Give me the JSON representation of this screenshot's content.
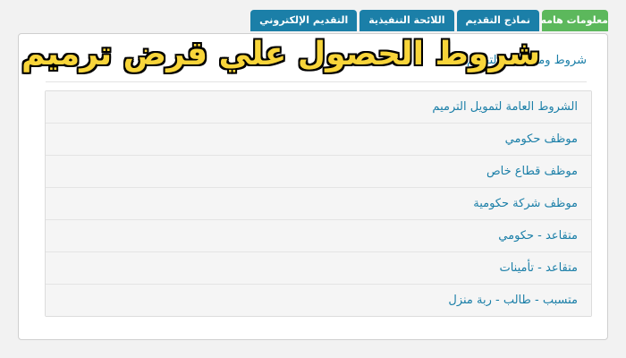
{
  "tabs": [
    {
      "label": "معلومات هامه",
      "active": true
    },
    {
      "label": "نماذج التقديم",
      "active": false
    },
    {
      "label": "اللائحة التنفيذية",
      "active": false
    },
    {
      "label": "التقديم الإلكتروني",
      "active": false
    }
  ],
  "panel": {
    "title": "شروط ومتطلبات التقديم"
  },
  "overlay": {
    "title": "شروط الحصول علي قرض ترميم"
  },
  "list_items": [
    "الشروط العامة لتمويل الترميم",
    "موظف حكومي",
    "موظف قطاع خاص",
    "موظف شركة حكومية",
    "متقاعد - حكومي",
    "متقاعد - تأمينات",
    "متسبب - طالب - ربة منزل"
  ],
  "colors": {
    "active_tab": "#5cb85c",
    "tab": "#1b7fa8",
    "link": "#1b7fa8",
    "overlay_text": "#f8d53a"
  }
}
